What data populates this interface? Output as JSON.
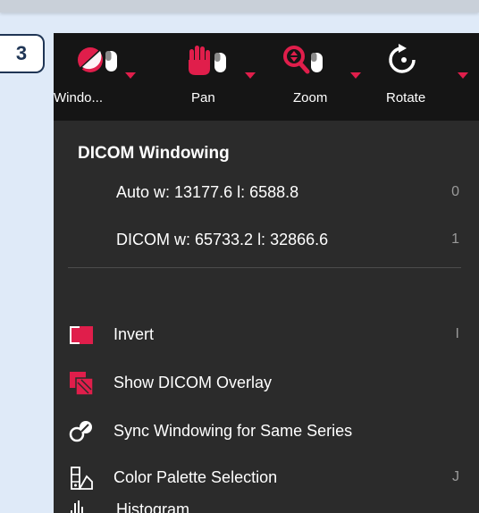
{
  "step_badge": "3",
  "toolbar": {
    "tools": [
      {
        "label": "Windo...",
        "icon": "window-level-icon"
      },
      {
        "label": "Pan",
        "icon": "hand-icon"
      },
      {
        "label": "Zoom",
        "icon": "zoom-icon"
      },
      {
        "label": "Rotate",
        "icon": "rotate-icon"
      }
    ],
    "accent": "#e01e4b"
  },
  "menu": {
    "section_title": "DICOM Windowing",
    "presets": [
      {
        "label": "Auto w: 13177.6 l: 6588.8",
        "shortcut": "0"
      },
      {
        "label": "DICOM w: 65733.2 l: 32866.6",
        "shortcut": "1"
      }
    ],
    "items": [
      {
        "label": "Invert",
        "shortcut": "I",
        "icon": "invert-icon"
      },
      {
        "label": "Show DICOM Overlay",
        "shortcut": "",
        "icon": "overlay-icon"
      },
      {
        "label": "Sync Windowing for Same Series",
        "shortcut": "",
        "icon": "sync-icon"
      },
      {
        "label": "Color Palette Selection",
        "shortcut": "J",
        "icon": "color-palette-icon"
      },
      {
        "label": "Histogram",
        "shortcut": "",
        "icon": "histogram-icon"
      }
    ]
  }
}
